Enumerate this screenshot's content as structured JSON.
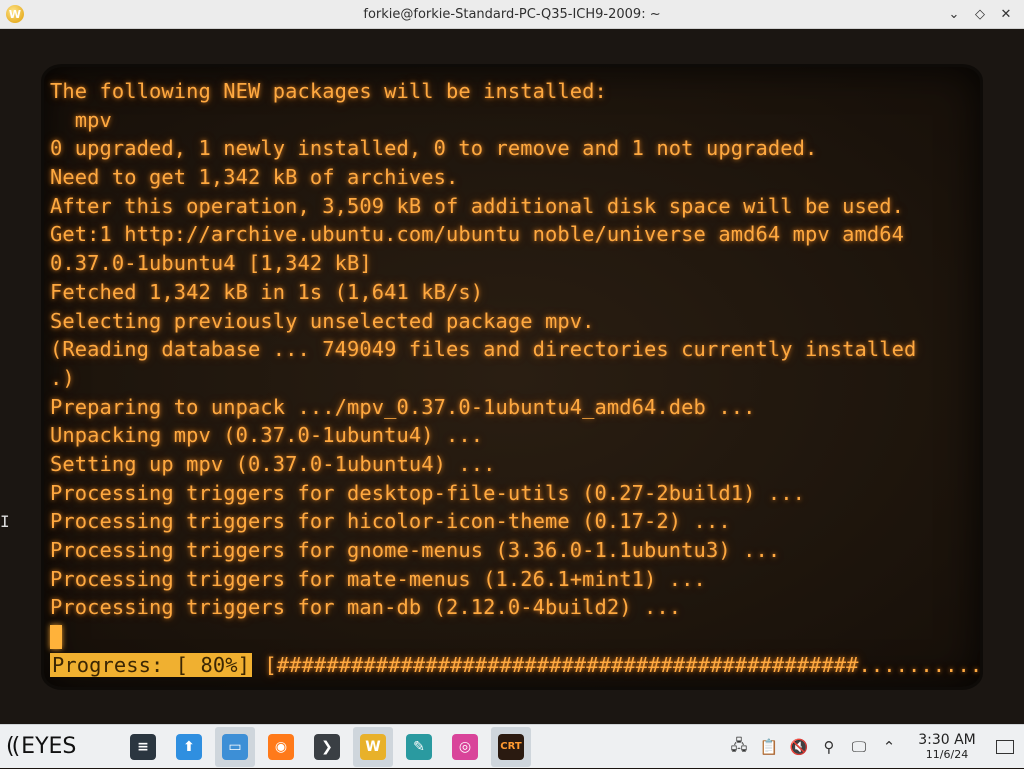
{
  "window": {
    "title": "forkie@forkie-Standard-PC-Q35-ICH9-2009: ~",
    "app_icon_letter": "W",
    "controls": {
      "minimize": "⌄",
      "maximize": "◇",
      "close": "✕"
    }
  },
  "terminal": {
    "lines": [
      "The following NEW packages will be installed:",
      "  mpv",
      "0 upgraded, 1 newly installed, 0 to remove and 1 not upgraded.",
      "Need to get 1,342 kB of archives.",
      "After this operation, 3,509 kB of additional disk space will be used.",
      "Get:1 http://archive.ubuntu.com/ubuntu noble/universe amd64 mpv amd64",
      "0.37.0-1ubuntu4 [1,342 kB]",
      "Fetched 1,342 kB in 1s (1,641 kB/s)",
      "Selecting previously unselected package mpv.",
      "(Reading database ... 749049 files and directories currently installed",
      ".)",
      "Preparing to unpack .../mpv_0.37.0-1ubuntu4_amd64.deb ...",
      "Unpacking mpv (0.37.0-1ubuntu4) ...",
      "Setting up mpv (0.37.0-1ubuntu4) ...",
      "Processing triggers for desktop-file-utils (0.27-2build1) ...",
      "Processing triggers for hicolor-icon-theme (0.17-2) ...",
      "Processing triggers for gnome-menus (3.36.0-1.1ubuntu3) ...",
      "Processing triggers for mate-menus (1.26.1+mint1) ...",
      "Processing triggers for man-db (2.12.0-4build2) ..."
    ],
    "progress_label": "Progress: [ 80%]",
    "progress_bar": " [###############################################..........]",
    "progress_percent": 80,
    "text_color": "#ffa940"
  },
  "taskbar": {
    "start_logo": "((",
    "start_label": "EYES",
    "apps": [
      {
        "name": "mixer-settings",
        "glyph": "≡",
        "color": "#2b3640"
      },
      {
        "name": "software-store",
        "glyph": "⬆",
        "color": "#2f8fe0"
      },
      {
        "name": "files",
        "glyph": "▭",
        "color": "#3d8fd6"
      },
      {
        "name": "firefox",
        "glyph": "◉",
        "color": "#ff7a1a"
      },
      {
        "name": "terminal",
        "glyph": "❯",
        "color": "#3a3f44"
      },
      {
        "name": "wine",
        "glyph": "W",
        "color": "#e8b12a"
      },
      {
        "name": "image-editor",
        "glyph": "✎",
        "color": "#2a9aa0"
      },
      {
        "name": "color-wheel",
        "glyph": "◎",
        "color": "#d9449a"
      },
      {
        "name": "crt-terminal",
        "glyph": "CRT",
        "color": "#2a1a10"
      }
    ],
    "tray": [
      "network-icon",
      "clipboard-icon",
      "mute-icon",
      "usb-icon",
      "display-icon",
      "expand-icon"
    ],
    "clock": {
      "time": "3:30 AM",
      "date": "11/6/24"
    }
  }
}
